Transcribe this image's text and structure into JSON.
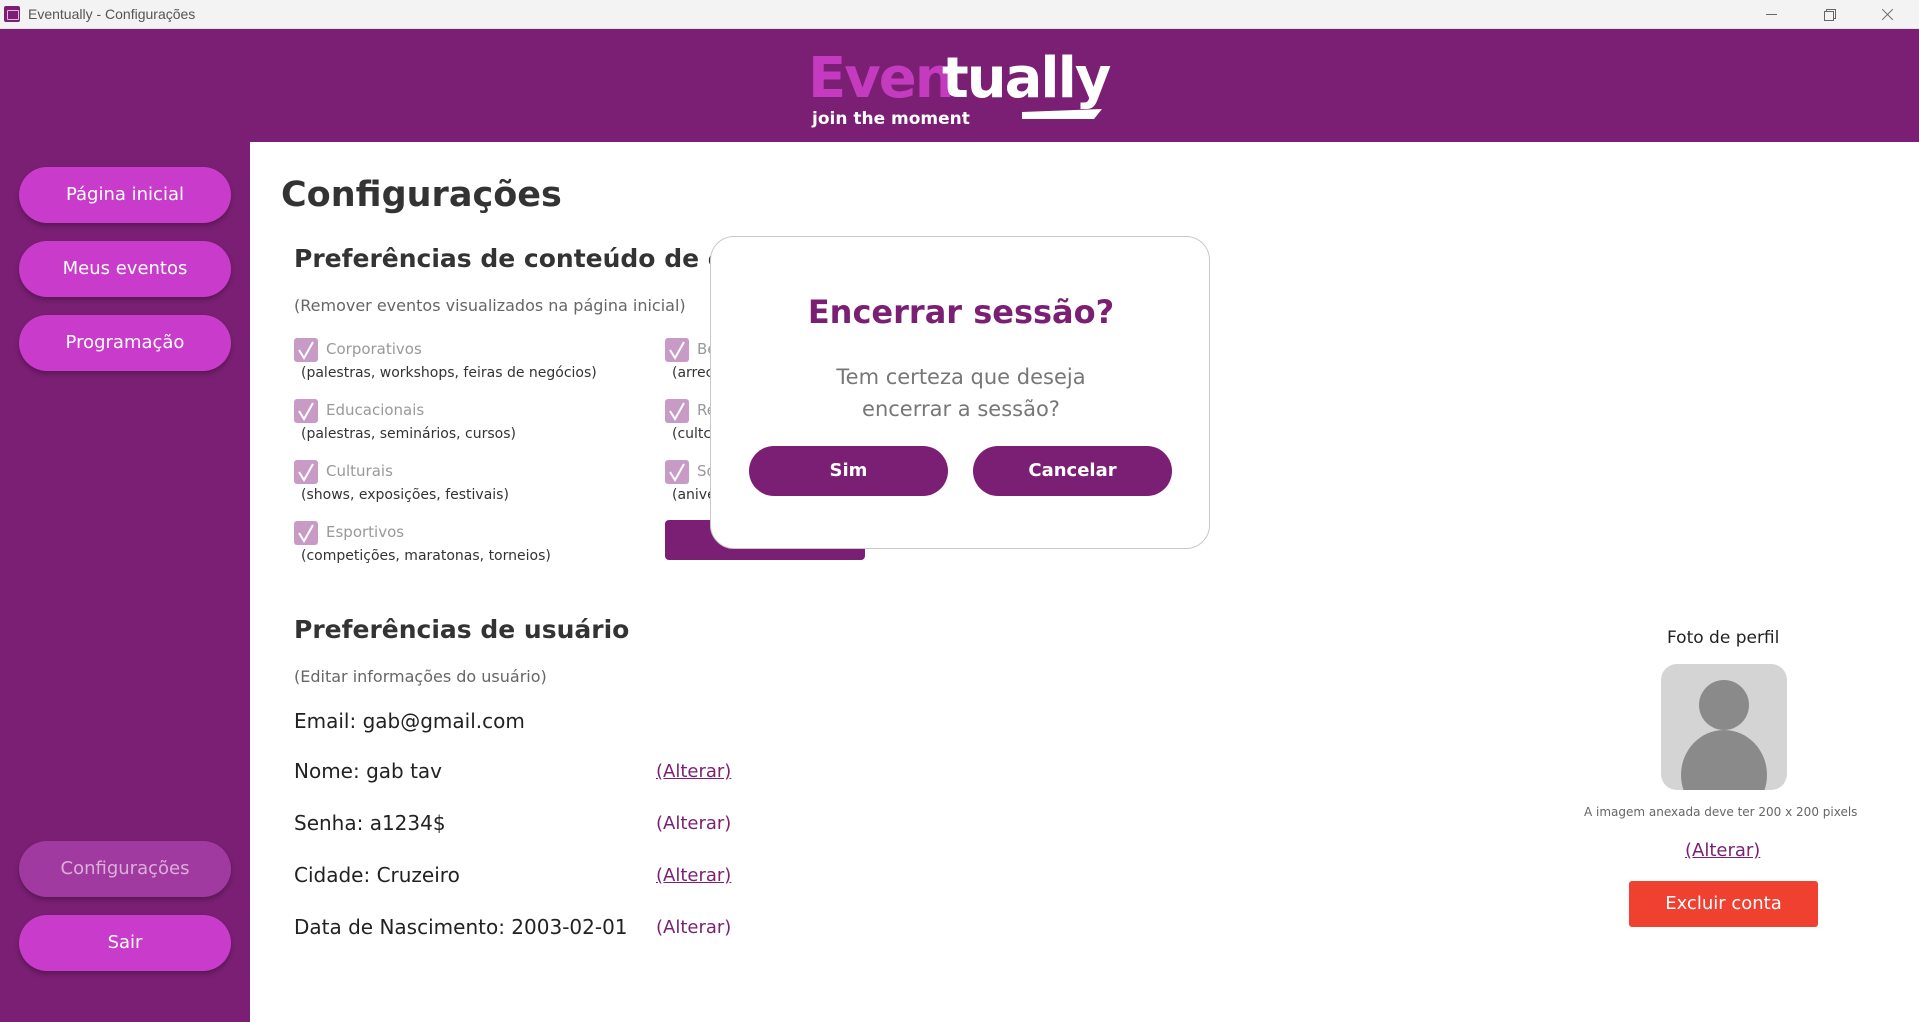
{
  "window": {
    "title": "Eventually - Configurações"
  },
  "header": {
    "brand_part1": "Even",
    "brand_part2": "tually",
    "tagline": "join the moment"
  },
  "sidebar": {
    "items": [
      {
        "label": "Página inicial"
      },
      {
        "label": "Meus eventos"
      },
      {
        "label": "Programação"
      }
    ],
    "settings_label": "Configurações",
    "logout_label": "Sair"
  },
  "page": {
    "title": "Configurações"
  },
  "content_prefs": {
    "title": "Preferências de conteúdo de con",
    "subtitle": "(Remover eventos visualizados na página inicial)",
    "left_items": [
      {
        "name": "Corporativos",
        "desc": "(palestras, workshops, feiras de negócios)"
      },
      {
        "name": "Educacionais",
        "desc": "(palestras, seminários, cursos)"
      },
      {
        "name": "Culturais",
        "desc": "(shows, exposições, festivais)"
      },
      {
        "name": "Esportivos",
        "desc": "(competições, maratonas, torneios)"
      }
    ],
    "right_items": [
      {
        "name": "Be",
        "desc": "(arrec"
      },
      {
        "name": "Re",
        "desc": "(cultc"
      },
      {
        "name": "So",
        "desc": "(anive"
      }
    ]
  },
  "user_prefs": {
    "title": "Preferências de usuário",
    "subtitle": "(Editar informações do usuário)",
    "email": "Email:  gab@gmail.com",
    "name": "Nome:  gab tav",
    "password": "Senha:  a1234$",
    "city": "Cidade:  Cruzeiro",
    "birth": "Data de Nascimento:  2003-02-01",
    "alter_label": "(Alterar)"
  },
  "profile_photo": {
    "label": "Foto de perfil",
    "note": "A imagem anexada deve ter 200 x 200 pixels",
    "alter_label": "(Alterar)",
    "delete_label": "Excluir conta"
  },
  "modal": {
    "title": "Encerrar sessão?",
    "message_line1": "Tem certeza que deseja",
    "message_line2": "encerrar a sessão?",
    "confirm_label": "Sim",
    "cancel_label": "Cancelar"
  },
  "colors": {
    "brand_purple": "#7a1f73",
    "nav_button": "#c93ccb",
    "danger": "#f04030"
  }
}
